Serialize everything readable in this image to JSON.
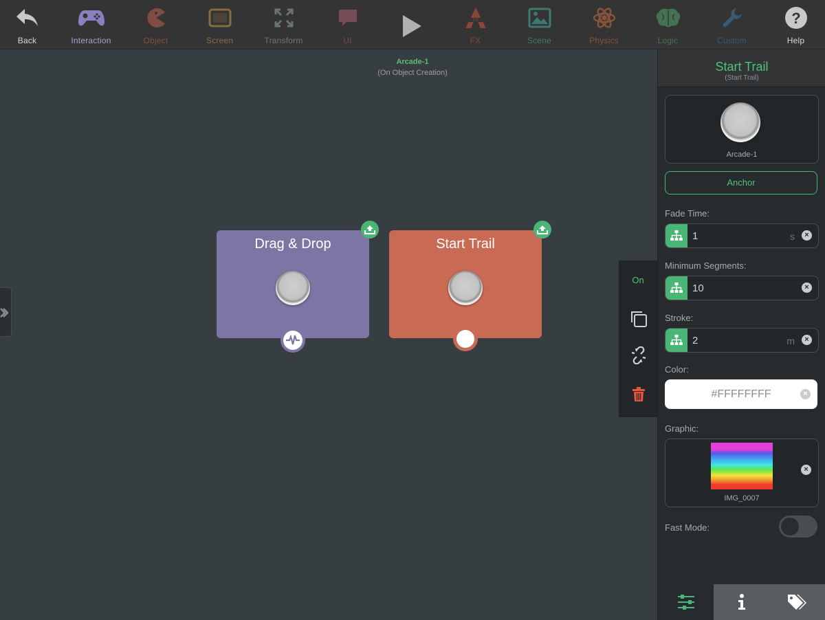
{
  "toolbar": {
    "items": [
      {
        "label": "Back",
        "icon": "back-arrow-icon",
        "color": "#c8c8c8"
      },
      {
        "label": "Interaction",
        "icon": "gamepad-icon",
        "color": "#8b7fc0"
      },
      {
        "label": "Object",
        "icon": "pacman-icon",
        "color": "#b65f53"
      },
      {
        "label": "Screen",
        "icon": "tablet-icon",
        "color": "#c99a4e"
      },
      {
        "label": "Transform",
        "icon": "expand-icon",
        "color": "#88a0a8"
      },
      {
        "label": "UI",
        "icon": "speech-bubble-icon",
        "color": "#b06272"
      },
      {
        "label": "",
        "icon": "play-icon",
        "color": "#9a9a9a"
      },
      {
        "label": "FX",
        "icon": "fx-icon",
        "color": "#d8563f"
      },
      {
        "label": "Scene",
        "icon": "image-icon",
        "color": "#3fb3a0"
      },
      {
        "label": "Physics",
        "icon": "atom-icon",
        "color": "#d46a3f"
      },
      {
        "label": "Logic",
        "icon": "brain-icon",
        "color": "#4fa36b"
      },
      {
        "label": "Custom",
        "icon": "wrench-icon",
        "color": "#3a79a8"
      },
      {
        "label": "Help",
        "icon": "help-icon",
        "color": "#c8c8c8"
      }
    ]
  },
  "canvas": {
    "object_name": "Arcade-1",
    "trigger": "(On Object Creation)",
    "nodes": [
      {
        "title": "Drag & Drop",
        "color": "#7d75a3"
      },
      {
        "title": "Start Trail",
        "color": "#c96a55"
      }
    ]
  },
  "context": {
    "on_label": "On"
  },
  "panel": {
    "title": "Start Trail",
    "subtitle": "(Start Trail)",
    "object_name": "Arcade-1",
    "anchor_label": "Anchor",
    "fade_time": {
      "label": "Fade Time:",
      "value": "1",
      "unit": "s"
    },
    "min_segments": {
      "label": "Minimum Segments:",
      "value": "10"
    },
    "stroke": {
      "label": "Stroke:",
      "value": "2",
      "unit": "m"
    },
    "color": {
      "label": "Color:",
      "value": "#FFFFFFFF"
    },
    "graphic": {
      "label": "Graphic:",
      "name": "IMG_0007"
    },
    "fast_mode": {
      "label": "Fast Mode:",
      "on": false
    }
  },
  "colors": {
    "accent": "#4ab574",
    "danger": "#e8553e"
  }
}
